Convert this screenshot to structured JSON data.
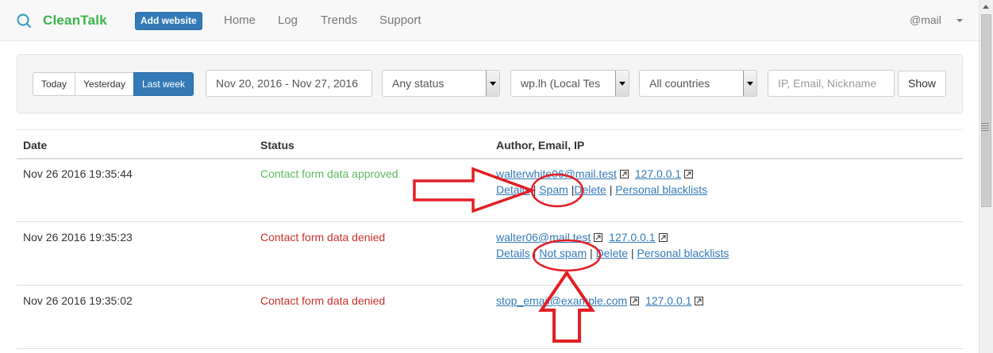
{
  "navbar": {
    "brand": "CleanTalk",
    "add_website": "Add website",
    "links": [
      "Home",
      "Log",
      "Trends",
      "Support"
    ],
    "user": "@mail"
  },
  "filters": {
    "ranges": [
      "Today",
      "Yesterday",
      "Last week"
    ],
    "active_range": "Last week",
    "date_range": "Nov 20, 2016 - Nov 27, 2016",
    "status_select": "Any status",
    "site_select": "wp.lh (Local Tes",
    "country_select": "All countries",
    "search_placeholder": "IP, Email, Nickname",
    "show_label": "Show"
  },
  "table": {
    "headers": [
      "Date",
      "Status",
      "Author, Email, IP"
    ],
    "rows": [
      {
        "date": "Nov 26 2016 19:35:44",
        "status": "Contact form data approved",
        "email": "walterwhite06@mail.test",
        "ip": "127.0.0.1",
        "actions": [
          "Details",
          "Spam",
          "Delete",
          "Personal blacklists"
        ]
      },
      {
        "date": "Nov 26 2016 19:35:23",
        "status": "Contact form data denied",
        "email": "walter06@mail.test",
        "ip": "127.0.0.1",
        "actions": [
          "Details",
          "Not spam",
          "Delete",
          "Personal blacklists"
        ]
      },
      {
        "date": "Nov 26 2016 19:35:02",
        "status": "Contact form data denied",
        "email": "stop_email@example.com",
        "ip": "127.0.0.1",
        "actions": []
      }
    ]
  },
  "colors": {
    "brand_green": "#39b54a",
    "primary": "#337ab7",
    "approved": "#5cb85c",
    "denied": "#c9302c",
    "annotation": "#e31e24"
  },
  "icons": [
    "logo-icon",
    "external-link-icon",
    "caret-down-icon",
    "select-arrow-icon"
  ]
}
